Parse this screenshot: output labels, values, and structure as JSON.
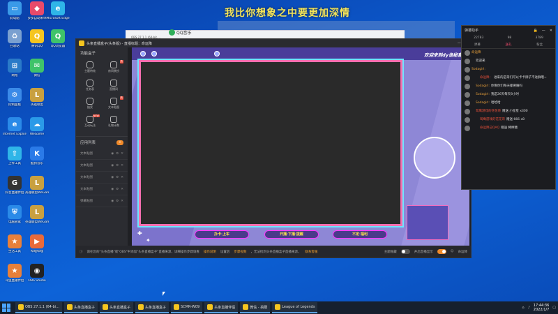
{
  "banner": {
    "text": "我比你想象之中要更加深情"
  },
  "desktop_icons": [
    {
      "label": "此电脑",
      "color": "#3a9ae8",
      "glyph": "▭"
    },
    {
      "label": "多多自动采单",
      "color": "#e84a6a",
      "glyph": "◆"
    },
    {
      "label": "Microsoft Edge",
      "color": "#2fb5e8",
      "glyph": "e"
    },
    {
      "label": "回收站",
      "color": "#7aa0d0",
      "glyph": "♻"
    },
    {
      "label": "腾讯QQ",
      "color": "#f5c51f",
      "glyph": "Q"
    },
    {
      "label": "QQ浏览器",
      "color": "#3fc36a",
      "glyph": "Q"
    },
    {
      "label": "网络",
      "color": "#2a7ac8",
      "glyph": "⊞"
    },
    {
      "label": "微信",
      "color": "#3fc36a",
      "glyph": "✉"
    },
    {
      "label": "控制面板",
      "color": "#3a8ae8",
      "glyph": "⚙"
    },
    {
      "label": "英雄联盟",
      "color": "#c8a040",
      "glyph": "L"
    },
    {
      "label": "Internet Explorer",
      "color": "#2a8ae8",
      "glyph": "e"
    },
    {
      "label": "WeGame",
      "color": "#2a9ae8",
      "glyph": "☁"
    },
    {
      "label": "上传工具",
      "color": "#2fb5e8",
      "glyph": "⇧"
    },
    {
      "label": "酷狗音乐",
      "color": "#2a7ae8",
      "glyph": "K"
    },
    {
      "label": "抖音直播伴侣",
      "color": "#333333",
      "glyph": "G"
    },
    {
      "label": "英雄联盟WeGame版",
      "color": "#c8a040",
      "glyph": "L"
    },
    {
      "label": "电脑管家",
      "color": "#2a8ae8",
      "glyph": "⛨"
    },
    {
      "label": "英雄联盟WeGame版",
      "color": "#c8a040",
      "glyph": "L"
    },
    {
      "label": "生活工具",
      "color": "#e8803a",
      "glyph": "★"
    },
    {
      "label": "哔哩哔哩",
      "color": "#e86a3a",
      "glyph": "▶"
    },
    {
      "label": "斗鱼直播伴侣",
      "color": "#e8803a",
      "glyph": "★"
    },
    {
      "label": "OBS Studio",
      "color": "#222222",
      "glyph": "◉"
    }
  ],
  "qq_window": {
    "title": "QQ音乐",
    "sub": "OBS 27.1.1 (64-bit,..."
  },
  "main_window": {
    "title": "头条直播盒子(头条版) - 直播标题：命运降",
    "sidebar": {
      "header": "功能盒子",
      "tools": [
        {
          "label": "主题特效",
          "badge": ""
        },
        {
          "label": "房间装扮",
          "badge": "热"
        },
        {
          "label": "任务表",
          "badge": ""
        },
        {
          "label": "直播间",
          "badge": ""
        },
        {
          "label": "抽奖",
          "badge": ""
        },
        {
          "label": "文本贴图",
          "badge": "热"
        },
        {
          "label": "互动玩法",
          "badge": "NEW"
        },
        {
          "label": "礼物计数",
          "badge": ""
        }
      ],
      "apps_header": "应用列表",
      "apps_add": "+",
      "apps": [
        "文本贴图",
        "文本贴图",
        "文本贴图",
        "文本贴图",
        "弹幕贴图"
      ]
    },
    "canvas": {
      "welcome": "欢迎来到dy诡秘直播",
      "pills": [
        "办卡·上车",
        "开播·下播·提醒",
        "不定·福利"
      ]
    },
    "footer": {
      "notice": "请在您的\"头条直播\"或\"OBS\"中添加\"头条直播盒子\"直播来源，详细操作步骤请看",
      "link1": "操作说明",
      "mid": "设置后",
      "link2": "步骤视频",
      "tail": "，无法找到头条直播盒子直播来源，",
      "link3": "联系客服",
      "toggle1_label": "主题隐藏",
      "toggle2_label": "开启直播显示",
      "user": "命运降"
    }
  },
  "chat": {
    "title": "弹幕助手",
    "stats": [
      "22783",
      "98",
      "3789"
    ],
    "tabs": [
      "弹幕",
      "送礼",
      "粉丝"
    ],
    "messages": [
      {
        "tags": [],
        "name": "命运降",
        "text": "",
        "red": false
      },
      {
        "tags": [
          "c"
        ],
        "name": "",
        "text": "欢迎来",
        "red": false
      },
      {
        "tags": [],
        "name": "Sodagirl:",
        "text": "",
        "red": false
      },
      {
        "tags": [
          "b",
          "c"
        ],
        "name": "命运降：",
        "text": "进来的是哥们可以卡卡牌子不进群哦~",
        "red": true
      },
      {
        "tags": [
          "y"
        ],
        "name": "Sodagirl:",
        "text": "你啊你们每天都要睡吗",
        "red": false
      },
      {
        "tags": [
          "y"
        ],
        "name": "Sodagirl:",
        "text": "我是26天每天8小时",
        "red": false
      },
      {
        "tags": [
          "y"
        ],
        "name": "Sodagirl:",
        "text": "哈哈哈",
        "red": false
      },
      {
        "tags": [
          "c"
        ],
        "name": "鸳鸯游戏的花花哥",
        "text": "赠送 小星星 x300",
        "red": true
      },
      {
        "tags": [
          "c",
          "y"
        ],
        "name": "鸳鸯游戏的花花哥",
        "text": "赠送 666 x8",
        "red": true
      },
      {
        "tags": [
          "y",
          "b"
        ],
        "name": "命运降已QAQ",
        "text": "赠送 棒棒糖",
        "red": true
      }
    ]
  },
  "taskbar": {
    "items": [
      "OBS 27.1.1 (64-bi...",
      "头条直播盒子",
      "头条直播盒子",
      "头条直播盒子",
      "SCMR-W09",
      "头条直播伴侣",
      "微信 - 搞砸",
      "League of Legends"
    ],
    "time": "17:44:36",
    "date": "2022/1/7"
  }
}
